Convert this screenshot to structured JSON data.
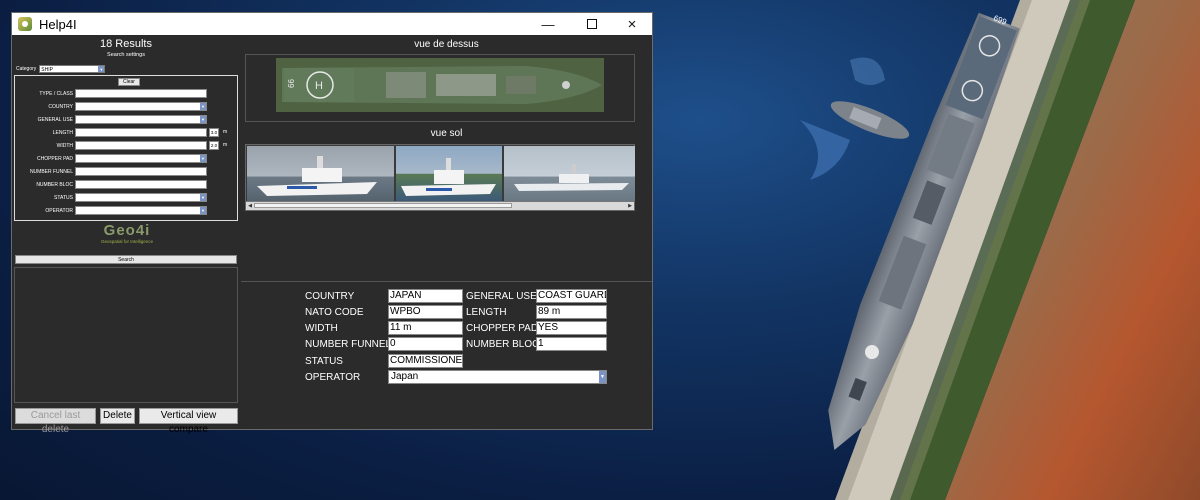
{
  "window": {
    "title": "Help4I"
  },
  "left_panel": {
    "results_count": "18 Results",
    "search_settings_label": "Search settings",
    "category_label": "Category",
    "category_value": "SHIP",
    "clear_label": "Clear",
    "fields": [
      {
        "label": "TYPE / CLASS"
      },
      {
        "label": "COUNTRY"
      },
      {
        "label": "GENERAL USE"
      },
      {
        "label": "LENGTH",
        "value": "3.0",
        "unit": "m"
      },
      {
        "label": "WIDTH",
        "value": "2.0",
        "unit": "m"
      },
      {
        "label": "CHOPPER PAD"
      },
      {
        "label": "NUMBER FUNNEL"
      },
      {
        "label": "NUMBER BLOC"
      },
      {
        "label": "STATUS"
      },
      {
        "label": "OPERATOR"
      }
    ],
    "logo_text": "Geo4i",
    "logo_tagline": "Geospatial for Intelligence",
    "search_label": "Search",
    "buttons": {
      "cancel_last_delete": "Cancel last delete",
      "delete": "Delete",
      "vertical_view_compare": "Vertical view compare"
    }
  },
  "right_panel": {
    "top_view_title": "vue de dessus",
    "top_view_hull_number": "99",
    "ground_view_title": "vue sol",
    "details": {
      "country_label": "COUNTRY",
      "country_value": "JAPAN",
      "general_use_label": "GENERAL USE",
      "general_use_value": "COAST GUARD",
      "nato_code_label": "NATO CODE",
      "nato_code_value": "WPBO",
      "length_label": "LENGTH",
      "length_value": "89 m",
      "width_label": "WIDTH",
      "width_value": "11 m",
      "chopper_pad_label": "CHOPPER PAD",
      "chopper_pad_value": "YES",
      "number_funnel_label": "NUMBER FUNNEL",
      "number_funnel_value": "0",
      "number_bloc_label": "NUMBER BLOC",
      "number_bloc_value": "1",
      "status_label": "STATUS",
      "status_value": "COMMISSIONED",
      "operator_label": "OPERATOR",
      "operator_value": "Japan"
    }
  },
  "background": {
    "deck_number": "699"
  },
  "colors": {
    "window_bg": "#2a2a2a",
    "sea": "#123463",
    "hull_grey": "#8e949c",
    "quay": "#c8c2b5",
    "soil_red": "#b5572f"
  }
}
